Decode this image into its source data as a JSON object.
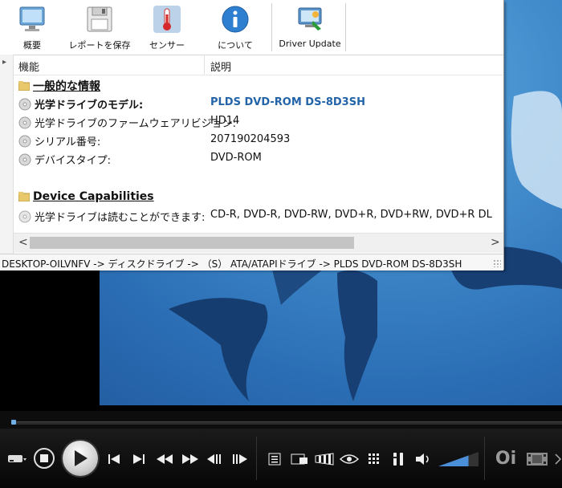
{
  "toolbar": {
    "buttons": [
      {
        "label": "概要",
        "icon": "monitor-icon"
      },
      {
        "label": "レポートを保存",
        "icon": "floppy-disk-icon"
      },
      {
        "label": "センサー",
        "icon": "thermometer-icon"
      },
      {
        "label": "について",
        "icon": "info-icon"
      },
      {
        "label": "Driver Update",
        "icon": "driver-update-icon"
      }
    ]
  },
  "grid": {
    "columns": [
      "機能",
      "説明"
    ],
    "rows": [
      {
        "type": "section",
        "feature": "一般的な情報",
        "value": ""
      },
      {
        "type": "bold",
        "feature": "光学ドライブのモデル:",
        "value": "PLDS DVD-ROM DS-8D3SH"
      },
      {
        "type": "normal",
        "feature": "光学ドライブのファームウェアリビジョン:",
        "value": "HD14"
      },
      {
        "type": "normal",
        "feature": "シリアル番号:",
        "value": "207190204593"
      },
      {
        "type": "normal",
        "feature": "デバイスタイプ:",
        "value": "DVD-ROM"
      },
      {
        "type": "section",
        "feature": "Device Capabilities",
        "value": ""
      },
      {
        "type": "normal",
        "feature": "光学ドライブは読むことができます:",
        "value": "CD-R, DVD-R, DVD-RW, DVD+R, DVD+RW, DVD+R DL"
      }
    ]
  },
  "scroll": {
    "left_arrow": "<",
    "right_arrow": ">"
  },
  "status": {
    "path": "DESKTOP-OILVNFV -> ディスクドライブ -> （S） ATA/ATAPIドライブ -> PLDS DVD-ROM DS-8D3SH"
  },
  "player": {
    "progress": 0.0,
    "volume": 0.75,
    "brand": "Oi",
    "accent": "#4a8fd8"
  }
}
